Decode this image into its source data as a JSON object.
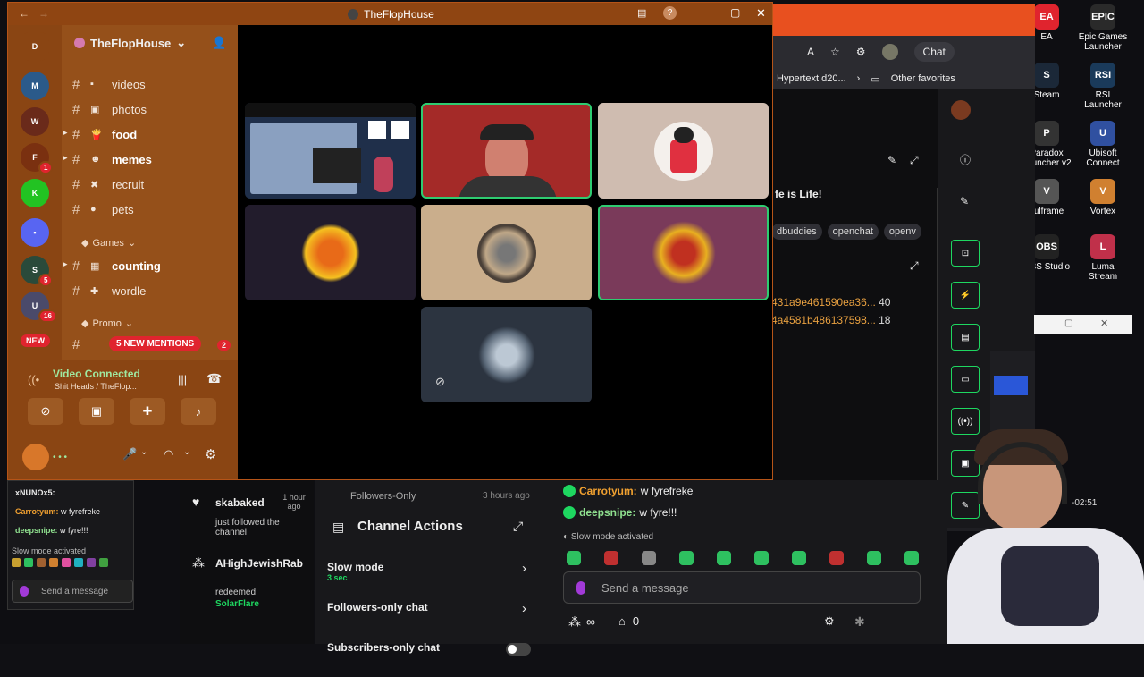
{
  "desktop": {
    "icons": [
      {
        "label": "EA",
        "color": "#e0242e",
        "glyph": "EA"
      },
      {
        "label": "Epic Games Launcher",
        "color": "#2a2a2a",
        "glyph": "EPIC"
      },
      {
        "label": "Steam",
        "color": "#1b2838",
        "glyph": "S"
      },
      {
        "label": "RSI Launcher",
        "color": "#1a3a5a",
        "glyph": "RSI"
      },
      {
        "label": "Paradox Launcher v2",
        "color": "#333",
        "glyph": "P"
      },
      {
        "label": "Ubisoft Connect",
        "color": "#3050a0",
        "glyph": "U"
      },
      {
        "label": "vulframe",
        "color": "#555",
        "glyph": "V"
      },
      {
        "label": "Vortex",
        "color": "#d08030",
        "glyph": "V"
      },
      {
        "label": "OBS Studio",
        "color": "#222",
        "glyph": "OBS"
      },
      {
        "label": "Luma Stream",
        "color": "#c0304a",
        "glyph": "L"
      }
    ]
  },
  "browser": {
    "chat_label": "Chat",
    "bookmark": "Hypertext d20...",
    "other_favorites": "Other favorites",
    "stream_title_fragment": "fe is Life!",
    "tags": [
      "dbuddies",
      "openchat",
      "openv"
    ],
    "hashes": [
      {
        "text": "431a9e461590ea36...",
        "count": "40"
      },
      {
        "text": "4a4581b486137598...",
        "count": "18"
      }
    ],
    "timer": "-02:51"
  },
  "discord": {
    "window_title": "TheFlopHouse",
    "server_name": "TheFlopHouse",
    "servers": [
      {
        "name": "discord-home-icon",
        "color": "#5865f2",
        "glyph": "D",
        "badge": ""
      },
      {
        "name": "server-missassist",
        "color": "#2b5a8a",
        "glyph": "M",
        "badge": ""
      },
      {
        "name": "server-warrior",
        "color": "#6a2a1a",
        "glyph": "W",
        "badge": ""
      },
      {
        "name": "server-fire",
        "color": "#7a3010",
        "glyph": "F",
        "badge": "1"
      },
      {
        "name": "server-kick",
        "color": "#22c322",
        "glyph": "K",
        "badge": ""
      },
      {
        "name": "server-folder",
        "color": "#5865f2",
        "glyph": "▪",
        "badge": ""
      },
      {
        "name": "server-skull",
        "color": "#2a4a3a",
        "glyph": "S",
        "badge": "5"
      },
      {
        "name": "server-user",
        "color": "#4a4a6a",
        "glyph": "U",
        "badge": "16"
      }
    ],
    "channels": [
      {
        "emoji": "▪",
        "label": "videos",
        "bold": false,
        "arrow": false
      },
      {
        "emoji": "▣",
        "label": "photos",
        "bold": false,
        "arrow": false
      },
      {
        "emoji": "🍟",
        "label": "food",
        "bold": true,
        "arrow": true
      },
      {
        "emoji": "☻",
        "label": "memes",
        "bold": true,
        "arrow": true
      },
      {
        "emoji": "✖",
        "label": "recruit",
        "bold": false,
        "arrow": false
      },
      {
        "emoji": "●",
        "label": "pets",
        "bold": false,
        "arrow": false
      }
    ],
    "category_games": "Games",
    "games_channels": [
      {
        "emoji": "▦",
        "label": "counting",
        "bold": true,
        "arrow": true
      },
      {
        "emoji": "✚",
        "label": "wordle",
        "bold": false,
        "arrow": false
      }
    ],
    "category_promo": "Promo",
    "new_label": "NEW",
    "mentions_label": "5 NEW MENTIONS",
    "mentions_count": "2",
    "voice_status": "Video Connected",
    "voice_channel": "Shit Heads / TheFlop...",
    "user_status": "• • •"
  },
  "bottom": {
    "left_chat": [
      {
        "user": "xNUNOx5:",
        "text": "",
        "color": "#e8e8e8"
      },
      {
        "user": "Carrotyum:",
        "text": "w fyrefreke",
        "color": "#f0a030"
      },
      {
        "user": "deepsnipe:",
        "text": "w fyre!!!",
        "color": "#8fe08f"
      }
    ],
    "left_slow_mode": "Slow mode activated",
    "left_send_placeholder": "Send a message",
    "activity": [
      {
        "user": "skabaked",
        "time": "1 hour ago",
        "text": "just followed the channel",
        "highlight": ""
      },
      {
        "user": "AHighJewishRab",
        "time": "",
        "text": "redeemed",
        "highlight": "SolarFlare"
      }
    ],
    "activity_header_fragment": "Followers-Only",
    "activity_header_time": "3 hours ago",
    "channel_actions_title": "Channel Actions",
    "actions": [
      {
        "label": "Slow mode",
        "sub": "3 sec",
        "control": "arrow"
      },
      {
        "label": "Followers-only chat",
        "sub": "",
        "control": "arrow"
      },
      {
        "label": "Subscribers-only chat",
        "sub": "",
        "control": "toggle"
      }
    ],
    "chat": [
      {
        "user": "Carrotyum:",
        "text": "w fyrefreke",
        "color": "#f0a030"
      },
      {
        "user": "deepsnipe:",
        "text": "w fyre!!!",
        "color": "#8fe08f"
      }
    ],
    "slow_mode": "Slow mode activated",
    "send_placeholder": "Send a message",
    "viewer_icon": "∞",
    "points": "0"
  },
  "colors": {
    "discord_orange": "#95501a",
    "twitch_green": "#1ed760",
    "accent_red": "#e0242e"
  }
}
